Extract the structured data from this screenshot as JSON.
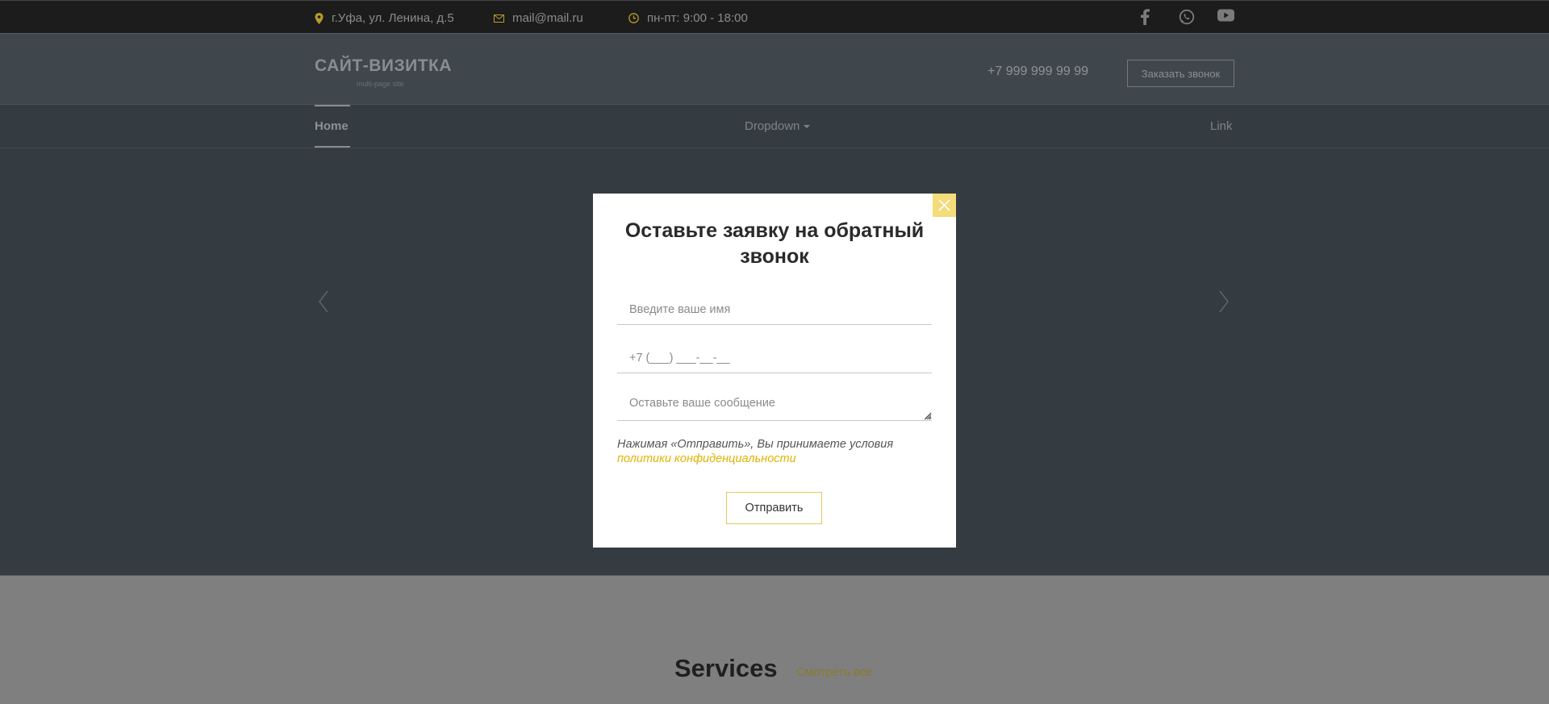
{
  "topbar": {
    "address": "г.Уфа, ул. Ленина, д.5",
    "email": "mail@mail.ru",
    "hours": "пн-пт: 9:00 - 18:00",
    "social_icons": [
      "facebook-icon",
      "whatsapp-icon",
      "youtube-icon"
    ],
    "accent_color": "#b59a2e"
  },
  "header": {
    "logo_title": "САЙТ-ВИЗИТКА",
    "logo_subtitle": "multi-page site",
    "phone": "+7 999 999 99 99",
    "callback_button": "Заказать звонок"
  },
  "nav": {
    "items": [
      {
        "label": "Home",
        "active": true
      },
      {
        "label": "Dropdown",
        "has_caret": true
      },
      {
        "label": "Link"
      }
    ]
  },
  "hero": {
    "prev_icon": "chevron-left-icon",
    "next_icon": "chevron-right-icon"
  },
  "services": {
    "title": "Services",
    "view_all": "Смотреть все"
  },
  "modal": {
    "title": "Оставьте заявку на обратный звонок",
    "name_placeholder": "Введите ваше имя",
    "phone_placeholder": "+7 (___) ___-__-__",
    "message_placeholder": "Оставьте ваше сообщение",
    "consent_text": "Нажимая «Отправить», Вы принимаете условия",
    "policy_link": "политики конфиденциальности",
    "submit_label": "Отправить",
    "close_color": "#f3dc79"
  }
}
